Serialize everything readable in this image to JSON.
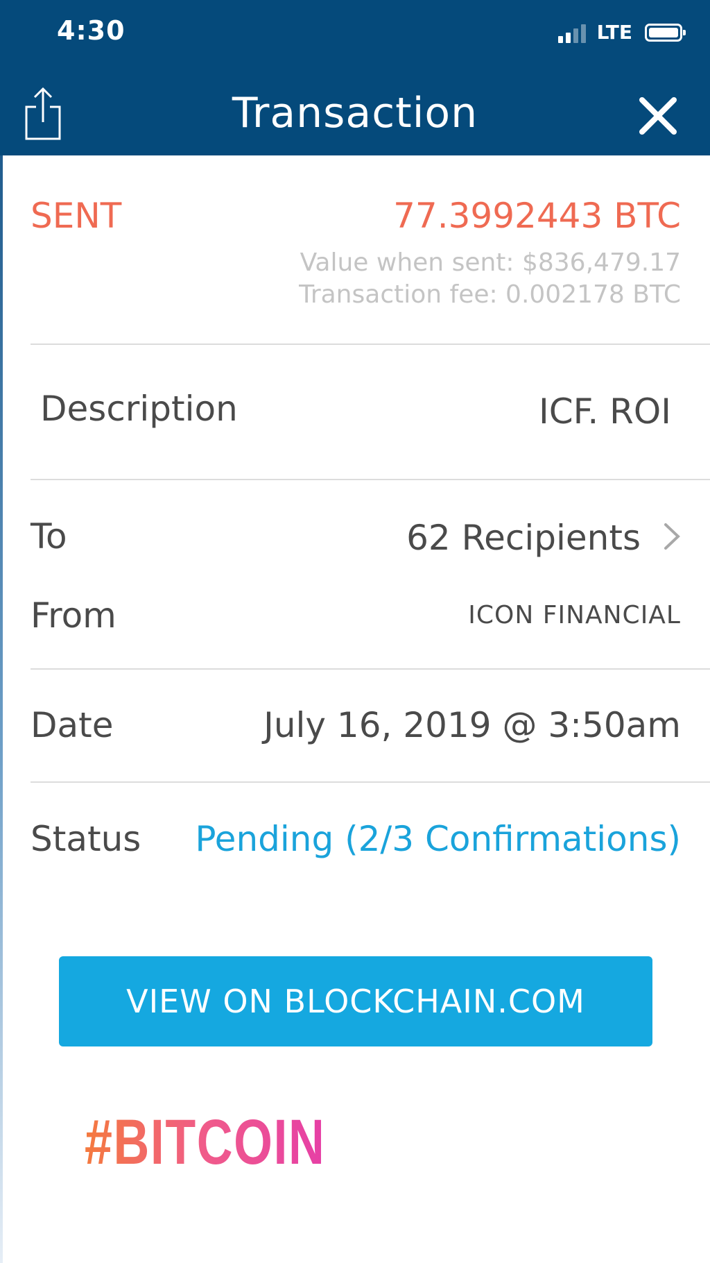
{
  "status_bar": {
    "time": "4:30",
    "network": "LTE"
  },
  "header": {
    "title": "Transaction"
  },
  "summary": {
    "direction": "SENT",
    "amount": "77.3992443 BTC",
    "value_when_sent": "Value when sent: $836,479.17",
    "fee": "Transaction fee: 0.002178 BTC"
  },
  "details": {
    "description_label": "Description",
    "description_value": "ICF. ROI",
    "to_label": "To",
    "to_value": "62 Recipients",
    "from_label": "From",
    "from_value": "ICON FINANCIAL",
    "date_label": "Date",
    "date_value": "July 16, 2019 @ 3:50am",
    "status_label": "Status",
    "status_value": "Pending (2/3 Confirmations)"
  },
  "actions": {
    "view_button": "VIEW ON BLOCKCHAIN.COM"
  },
  "sticker": {
    "hashtag": "#BITCOIN"
  },
  "colors": {
    "header_bg": "#054a7b",
    "sent": "#ef6a52",
    "status_pending": "#1aa3db",
    "button_bg": "#15a8e0"
  }
}
